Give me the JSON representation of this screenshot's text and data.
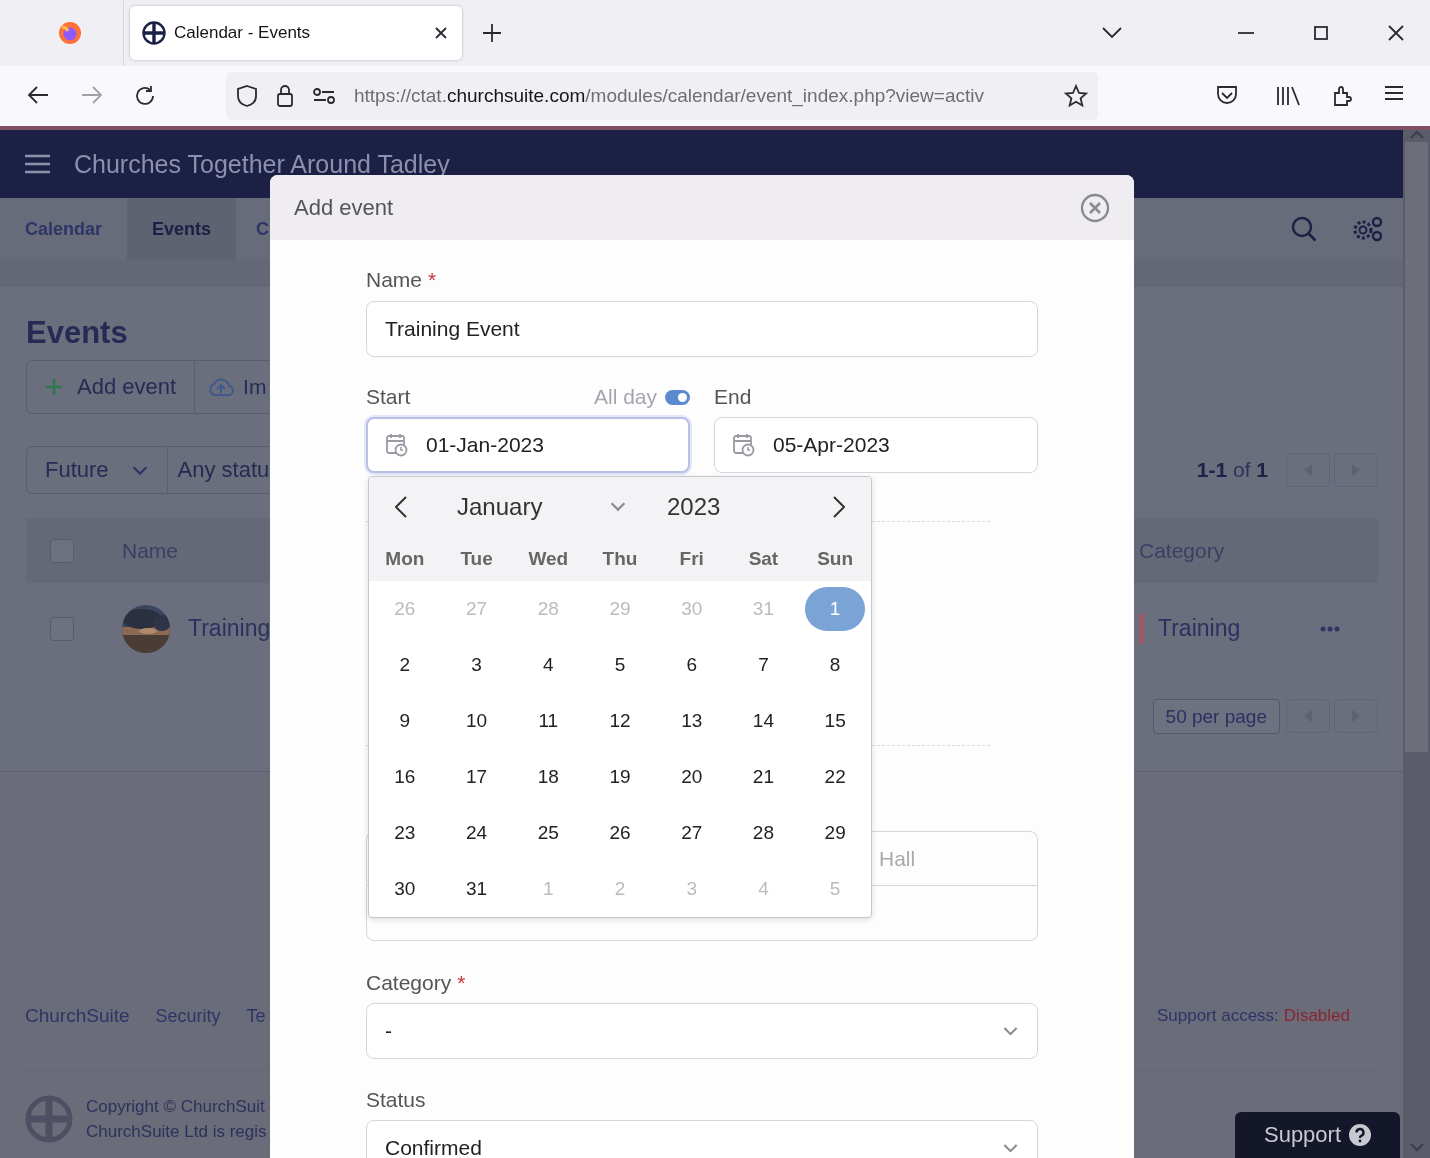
{
  "browser": {
    "tab_title": "Calendar - Events",
    "url": {
      "prefix": "https://ctat.",
      "domain": "churchsuite.com",
      "path": "/modules/calendar/event_index.php?view=activ"
    }
  },
  "app": {
    "title": "Churches Together Around Tadley",
    "nav": [
      {
        "label": "Calendar",
        "selected": false
      },
      {
        "label": "Events",
        "selected": true
      },
      {
        "label": "C",
        "selected": false
      }
    ],
    "heading": "Events",
    "actions": [
      {
        "label": "Add event",
        "kind": "add"
      },
      {
        "label": "Im",
        "kind": "import"
      }
    ],
    "filters": [
      {
        "label": "Future",
        "kind": "dropdown"
      },
      {
        "label": "Any statu",
        "kind": "text"
      }
    ],
    "range": "**1-1** of **1**",
    "table": {
      "select_all": {
        "checked": false
      },
      "columns": [
        {
          "label": "Name"
        },
        {
          "label": "Category"
        }
      ],
      "rows": [
        {
          "checked": false,
          "name": "Training",
          "category": "Training",
          "color": "#9c5868"
        }
      ]
    },
    "per_page": "50 per page",
    "footer": {
      "links": [
        "ChurchSuite",
        "Security",
        "Te"
      ],
      "support_label": "Support access:",
      "support_value": "Disabled",
      "copyright": [
        "Copyright © ChurchSuit",
        "ChurchSuite Ltd is regis"
      ],
      "support_button": "Support"
    }
  },
  "modal": {
    "title": "Add event",
    "name": {
      "label": "Name",
      "required_mark": "*",
      "value": "Training Event"
    },
    "start": {
      "label": "Start",
      "value": "01-Jan-2023"
    },
    "all_day": {
      "label": "All day",
      "on": true
    },
    "end": {
      "label": "End",
      "value": "05-Apr-2023"
    },
    "location": {
      "placeholder": "Hall"
    },
    "category": {
      "label": "Category",
      "required_mark": "*",
      "value": "-"
    },
    "status": {
      "label": "Status",
      "value": "Confirmed"
    },
    "datepicker": {
      "month": "January",
      "year": "2023",
      "weekdays": [
        "Mon",
        "Tue",
        "Wed",
        "Thu",
        "Fri",
        "Sat",
        "Sun"
      ],
      "weeks": [
        [
          {
            "day": "26",
            "outside": true,
            "selected": false
          },
          {
            "day": "27",
            "outside": true,
            "selected": false
          },
          {
            "day": "28",
            "outside": true,
            "selected": false
          },
          {
            "day": "29",
            "outside": true,
            "selected": false
          },
          {
            "day": "30",
            "outside": true,
            "selected": false
          },
          {
            "day": "31",
            "outside": true,
            "selected": false
          },
          {
            "day": "1",
            "outside": false,
            "selected": true
          }
        ],
        [
          {
            "day": "2",
            "outside": false,
            "selected": false
          },
          {
            "day": "3",
            "outside": false,
            "selected": false
          },
          {
            "day": "4",
            "outside": false,
            "selected": false
          },
          {
            "day": "5",
            "outside": false,
            "selected": false
          },
          {
            "day": "6",
            "outside": false,
            "selected": false
          },
          {
            "day": "7",
            "outside": false,
            "selected": false
          },
          {
            "day": "8",
            "outside": false,
            "selected": false
          }
        ],
        [
          {
            "day": "9",
            "outside": false,
            "selected": false
          },
          {
            "day": "10",
            "outside": false,
            "selected": false
          },
          {
            "day": "11",
            "outside": false,
            "selected": false
          },
          {
            "day": "12",
            "outside": false,
            "selected": false
          },
          {
            "day": "13",
            "outside": false,
            "selected": false
          },
          {
            "day": "14",
            "outside": false,
            "selected": false
          },
          {
            "day": "15",
            "outside": false,
            "selected": false
          }
        ],
        [
          {
            "day": "16",
            "outside": false,
            "selected": false
          },
          {
            "day": "17",
            "outside": false,
            "selected": false
          },
          {
            "day": "18",
            "outside": false,
            "selected": false
          },
          {
            "day": "19",
            "outside": false,
            "selected": false
          },
          {
            "day": "20",
            "outside": false,
            "selected": false
          },
          {
            "day": "21",
            "outside": false,
            "selected": false
          },
          {
            "day": "22",
            "outside": false,
            "selected": false
          }
        ],
        [
          {
            "day": "23",
            "outside": false,
            "selected": false
          },
          {
            "day": "24",
            "outside": false,
            "selected": false
          },
          {
            "day": "25",
            "outside": false,
            "selected": false
          },
          {
            "day": "26",
            "outside": false,
            "selected": false
          },
          {
            "day": "27",
            "outside": false,
            "selected": false
          },
          {
            "day": "28",
            "outside": false,
            "selected": false
          },
          {
            "day": "29",
            "outside": false,
            "selected": false
          }
        ],
        [
          {
            "day": "30",
            "outside": false,
            "selected": false
          },
          {
            "day": "31",
            "outside": false,
            "selected": false
          },
          {
            "day": "1",
            "outside": true,
            "selected": false
          },
          {
            "day": "2",
            "outside": true,
            "selected": false
          },
          {
            "day": "3",
            "outside": true,
            "selected": false
          },
          {
            "day": "4",
            "outside": true,
            "selected": false
          },
          {
            "day": "5",
            "outside": true,
            "selected": false
          }
        ]
      ]
    }
  }
}
